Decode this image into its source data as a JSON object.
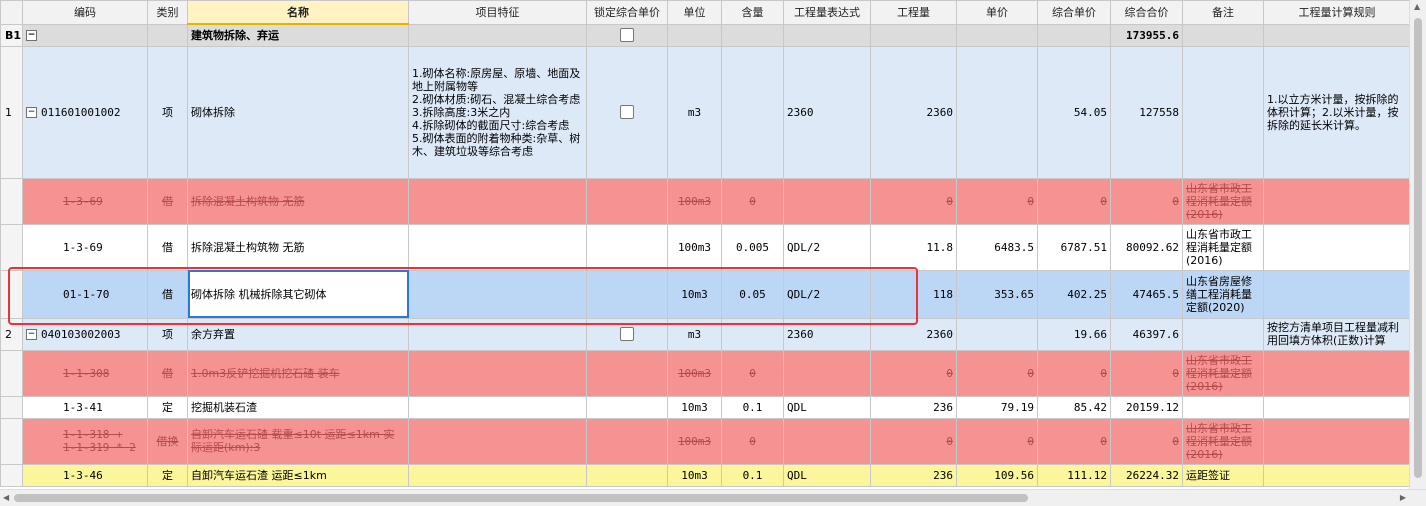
{
  "columns": [
    "编码",
    "类别",
    "名称",
    "项目特征",
    "锁定综合单价",
    "单位",
    "含量",
    "工程量表达式",
    "工程量",
    "单价",
    "综合单价",
    "综合合价",
    "备注",
    "工程量计算规则"
  ],
  "group": {
    "id": "B1",
    "name": "建筑物拆除、弃运",
    "total": "173955.6"
  },
  "rows": [
    {
      "idx": "1",
      "code": "011601001002",
      "cat": "项",
      "name": "砌体拆除",
      "feature": "1.砌体名称:原房屋、原墙、地面及地上附属物等\n2.砌体材质:砌石、混凝土综合考虑\n3.拆除高度:3米之内\n4.拆除砌体的截面尺寸:综合考虑\n5.砌体表面的附着物种类:杂草、树木、建筑垃圾等综合考虑",
      "unit": "m3",
      "qty": "",
      "expr": "2360",
      "amount": "2360",
      "price": "",
      "uprice": "54.05",
      "total": "127558",
      "note": "",
      "rule": "1.以立方米计量，按拆除的体积计算；2.以米计量，按拆除的延长米计算。"
    },
    {
      "idx": "",
      "code": "1-3-69",
      "cat": "借",
      "name": "拆除混凝土构筑物 无筋",
      "feature": "",
      "unit": "100m3",
      "qty": "0",
      "expr": "",
      "amount": "0",
      "price": "0",
      "uprice": "0",
      "total": "0",
      "note": "山东省市政工程消耗量定额(2016)",
      "rule": ""
    },
    {
      "idx": "",
      "code": "1-3-69",
      "cat": "借",
      "name": "拆除混凝土构筑物 无筋",
      "feature": "",
      "unit": "100m3",
      "qty": "0.005",
      "expr": "QDL/2",
      "amount": "11.8",
      "price": "6483.5",
      "uprice": "6787.51",
      "total": "80092.62",
      "note": "山东省市政工程消耗量定额(2016)",
      "rule": ""
    },
    {
      "idx": "",
      "code": "01-1-70",
      "cat": "借",
      "name": "砌体拆除 机械拆除其它砌体",
      "feature": "",
      "unit": "10m3",
      "qty": "0.05",
      "expr": "QDL/2",
      "amount": "118",
      "price": "353.65",
      "uprice": "402.25",
      "total": "47465.5",
      "note": "山东省房屋修缮工程消耗量定额(2020)",
      "rule": ""
    },
    {
      "idx": "2",
      "code": "040103002003",
      "cat": "项",
      "name": "余方弃置",
      "feature": "",
      "unit": "m3",
      "qty": "",
      "expr": "2360",
      "amount": "2360",
      "price": "",
      "uprice": "19.66",
      "total": "46397.6",
      "note": "",
      "rule": "按挖方清单项目工程量减利用回填方体积(正数)计算"
    },
    {
      "idx": "",
      "code": "1-1-308",
      "cat": "借",
      "name": "1.0m3反铲挖掘机挖石碴 装车",
      "feature": "",
      "unit": "100m3",
      "qty": "0",
      "expr": "",
      "amount": "0",
      "price": "0",
      "uprice": "0",
      "total": "0",
      "note": "山东省市政工程消耗量定额(2016)",
      "rule": ""
    },
    {
      "idx": "",
      "code": "1-3-41",
      "cat": "定",
      "name": "挖掘机装石渣",
      "feature": "",
      "unit": "10m3",
      "qty": "0.1",
      "expr": "QDL",
      "amount": "236",
      "price": "79.19",
      "uprice": "85.42",
      "total": "20159.12",
      "note": "",
      "rule": ""
    },
    {
      "idx": "",
      "code": "1-1-318 +\n1-1-319 * 2",
      "cat": "借换",
      "name": "自卸汽车运石碴 载重≤10t 运距≤1km 实际运距(km):3",
      "feature": "",
      "unit": "100m3",
      "qty": "0",
      "expr": "",
      "amount": "0",
      "price": "0",
      "uprice": "0",
      "total": "0",
      "note": "山东省市政工程消耗量定额(2016)",
      "rule": ""
    },
    {
      "idx": "",
      "code": "1-3-46",
      "cat": "定",
      "name": "自卸汽车运石渣 运距≤1km",
      "feature": "",
      "unit": "10m3",
      "qty": "0.1",
      "expr": "QDL",
      "amount": "236",
      "price": "109.56",
      "uprice": "111.12",
      "total": "26224.32",
      "note": "运距签证",
      "rule": ""
    }
  ]
}
